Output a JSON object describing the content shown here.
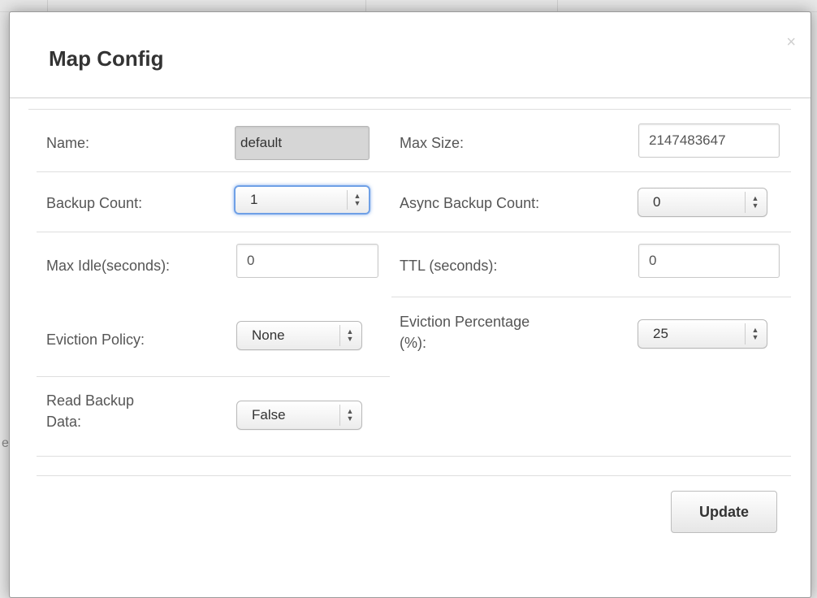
{
  "modal": {
    "title": "Map Config",
    "close_glyph": "×"
  },
  "background": {
    "partial_letter": "e"
  },
  "form": {
    "name": {
      "label": "Name:",
      "value": "default"
    },
    "max_size": {
      "label": "Max Size:",
      "value": "2147483647"
    },
    "backup_count": {
      "label": "Backup Count:",
      "value": "1"
    },
    "async_backup_count": {
      "label": "Async Backup Count:",
      "value": "0"
    },
    "max_idle": {
      "label": "Max Idle(seconds):",
      "value": "0"
    },
    "ttl": {
      "label": "TTL (seconds):",
      "value": "0"
    },
    "eviction_policy": {
      "label": "Eviction Policy:",
      "value": "None"
    },
    "eviction_percentage": {
      "label_line1": "Eviction Percentage",
      "label_line2": "(%):",
      "value": "25"
    },
    "read_backup_data": {
      "label_line1": "Read Backup",
      "label_line2": "Data:",
      "value": "False"
    }
  },
  "footer": {
    "update_label": "Update"
  },
  "icons": {
    "select_arrows": "updown-arrows-icon",
    "close": "close-icon"
  }
}
